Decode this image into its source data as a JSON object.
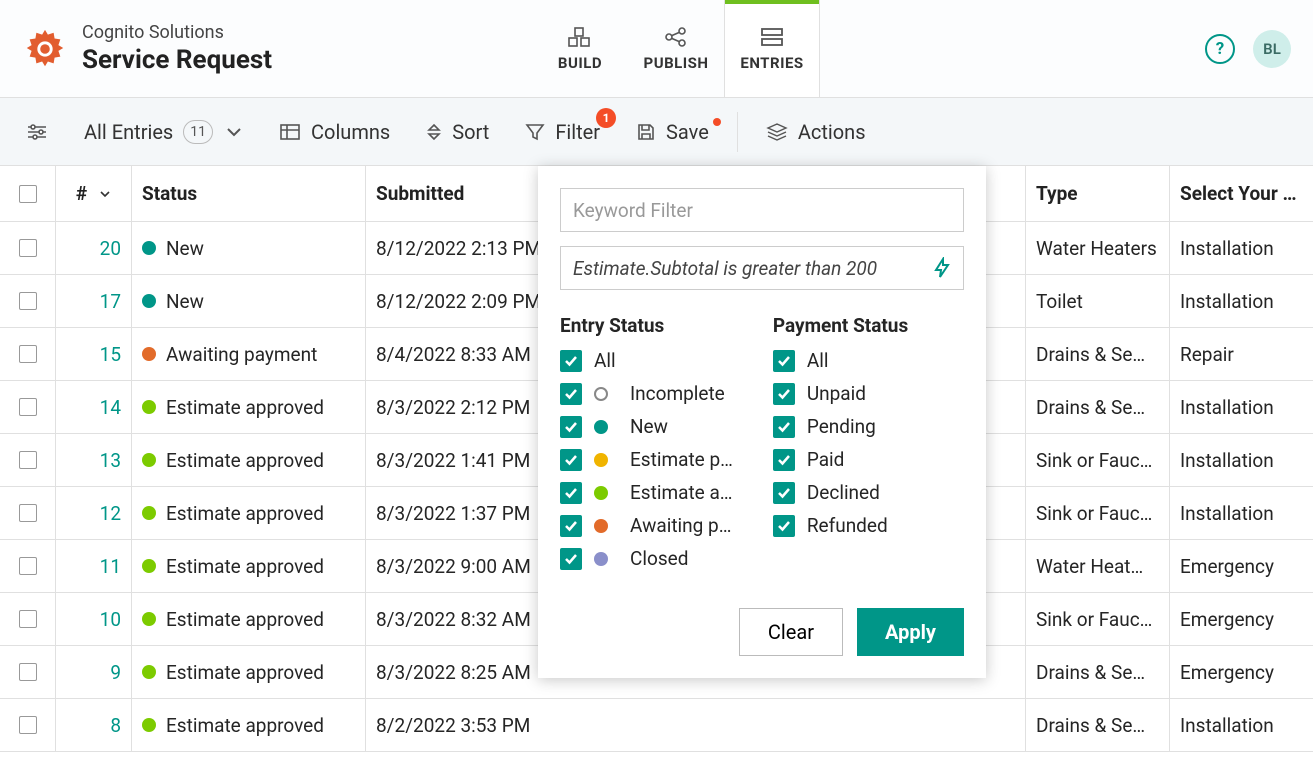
{
  "header": {
    "org": "Cognito Solutions",
    "title": "Service Request",
    "avatar_initials": "BL",
    "help_symbol": "?"
  },
  "nav": {
    "build": "BUILD",
    "publish": "PUBLISH",
    "entries": "ENTRIES"
  },
  "toolbar": {
    "all_entries": "All Entries",
    "entries_count": "11",
    "columns": "Columns",
    "sort": "Sort",
    "filter": "Filter",
    "filter_count": "1",
    "save": "Save",
    "actions": "Actions"
  },
  "columns": {
    "num": "#",
    "status": "Status",
    "submitted": "Submitted",
    "type": "Type",
    "select": "Select Your …"
  },
  "rows": [
    {
      "num": "20",
      "status": "New",
      "dot": "dot-new",
      "submitted": "8/12/2022 2:13 PM",
      "type": "Water Heaters",
      "select": "Installation"
    },
    {
      "num": "17",
      "status": "New",
      "dot": "dot-new",
      "submitted": "8/12/2022 2:09 PM",
      "type": "Toilet",
      "select": "Installation"
    },
    {
      "num": "15",
      "status": "Awaiting payment",
      "dot": "dot-awaiting",
      "submitted": "8/4/2022 8:33 AM",
      "type": "Drains & Se…",
      "select": "Repair"
    },
    {
      "num": "14",
      "status": "Estimate approved",
      "dot": "dot-approved",
      "submitted": "8/3/2022 2:12 PM",
      "type": "Drains & Se…",
      "select": "Installation"
    },
    {
      "num": "13",
      "status": "Estimate approved",
      "dot": "dot-approved",
      "submitted": "8/3/2022 1:41 PM",
      "type": "Sink or Fauc…",
      "select": "Installation"
    },
    {
      "num": "12",
      "status": "Estimate approved",
      "dot": "dot-approved",
      "submitted": "8/3/2022 1:37 PM",
      "type": "Sink or Fauc…",
      "select": "Installation"
    },
    {
      "num": "11",
      "status": "Estimate approved",
      "dot": "dot-approved",
      "submitted": "8/3/2022 9:00 AM",
      "type": "Water Heat…",
      "select": "Emergency"
    },
    {
      "num": "10",
      "status": "Estimate approved",
      "dot": "dot-approved",
      "submitted": "8/3/2022 8:32 AM",
      "type": "Sink or Fauc…",
      "select": "Emergency"
    },
    {
      "num": "9",
      "status": "Estimate approved",
      "dot": "dot-approved",
      "submitted": "8/3/2022 8:25 AM",
      "type": "Drains & Se…",
      "select": "Emergency"
    },
    {
      "num": "8",
      "status": "Estimate approved",
      "dot": "dot-approved",
      "submitted": "8/2/2022 3:53 PM",
      "type": "Drains & Se…",
      "select": "Installation"
    }
  ],
  "filter": {
    "keyword_placeholder": "Keyword Filter",
    "expression": "Estimate.Subtotal is greater than 200",
    "entry_status_title": "Entry Status",
    "payment_status_title": "Payment Status",
    "entry_status": [
      {
        "label": "All",
        "dot": ""
      },
      {
        "label": "Incomplete",
        "dot": "dot-incomplete"
      },
      {
        "label": "New",
        "dot": "dot-new"
      },
      {
        "label": "Estimate p…",
        "dot": "dot-pending-est"
      },
      {
        "label": "Estimate a…",
        "dot": "dot-approved"
      },
      {
        "label": "Awaiting p…",
        "dot": "dot-awaiting"
      },
      {
        "label": "Closed",
        "dot": "dot-closed"
      }
    ],
    "payment_status": [
      {
        "label": "All"
      },
      {
        "label": "Unpaid"
      },
      {
        "label": "Pending"
      },
      {
        "label": "Paid"
      },
      {
        "label": "Declined"
      },
      {
        "label": "Refunded"
      }
    ],
    "clear": "Clear",
    "apply": "Apply"
  }
}
